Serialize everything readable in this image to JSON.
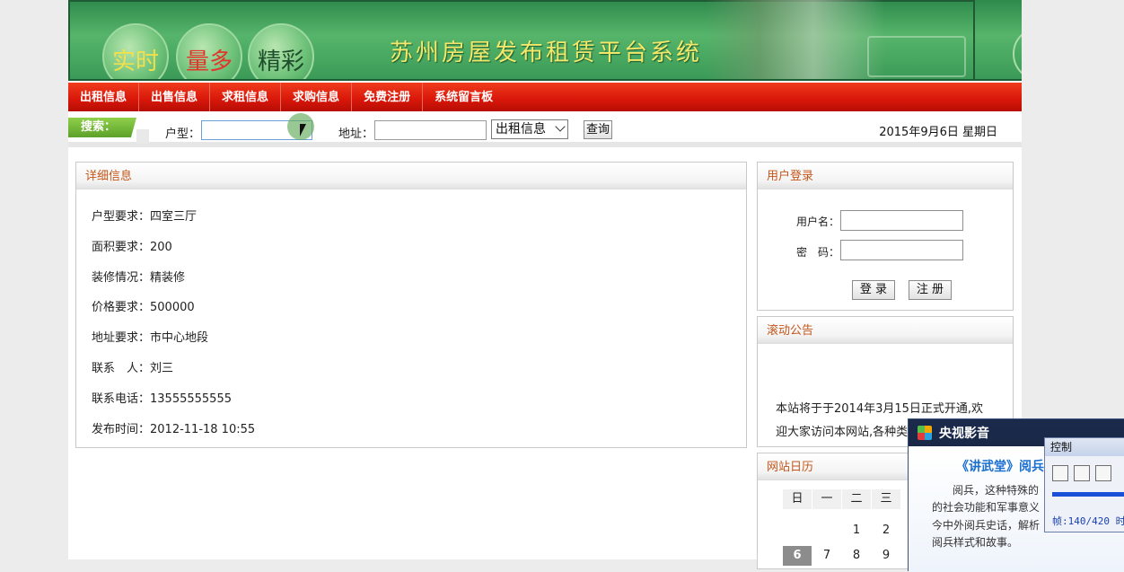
{
  "banner": {
    "bubbles": [
      "实时",
      "量多",
      "精彩"
    ],
    "title": "苏州房屋发布租赁平台系统"
  },
  "nav": {
    "items": [
      "出租信息",
      "出售信息",
      "求租信息",
      "求购信息",
      "免费注册",
      "系统留言板"
    ]
  },
  "search": {
    "tag": "搜索：",
    "type_label": "户型：",
    "type_value": "",
    "address_label": "地址：",
    "address_value": "",
    "category_selected": "出租信息",
    "query_button": "查询",
    "date": "2015年9月6日 星期日"
  },
  "detail": {
    "heading": "详细信息",
    "rows": [
      "户型要求：四室三厅",
      "面积要求：200",
      "装修情况：精装修",
      "价格要求：500000",
      "地址要求：市中心地段",
      "联系　人：刘三",
      "联系电话：13555555555",
      "发布时间：2012-11-18 10:55"
    ]
  },
  "login": {
    "heading": "用户登录",
    "username_label": "用户名：",
    "password_label": "密　码：",
    "login_button": "登 录",
    "register_button": "注 册"
  },
  "notice": {
    "heading": "滚动公告",
    "line1": "本站将于于2014年3月15日正式开通,欢",
    "line2": "迎大家访问本网站,各种类"
  },
  "calendar": {
    "heading": "网站日历",
    "weekdays": [
      "日",
      "一",
      "二",
      "三"
    ],
    "row1": [
      "",
      "",
      "1",
      "2"
    ],
    "row2": [
      "6",
      "7",
      "8",
      "9"
    ],
    "today": "6"
  },
  "popup": {
    "app_name": "央视影音",
    "title": "《讲武堂》阅兵",
    "lines": [
      "阅兵，这种特殊的",
      "的社会功能和军事意义",
      "今中外阅兵史话，解析",
      "阅兵样式和故事。"
    ]
  },
  "control": {
    "title": "控制",
    "frame_readout": "帧:140/420 时"
  },
  "colors": {
    "nav_red": "#d8160a",
    "banner_green": "#3b9a57",
    "heading_orange": "#c4561a"
  }
}
